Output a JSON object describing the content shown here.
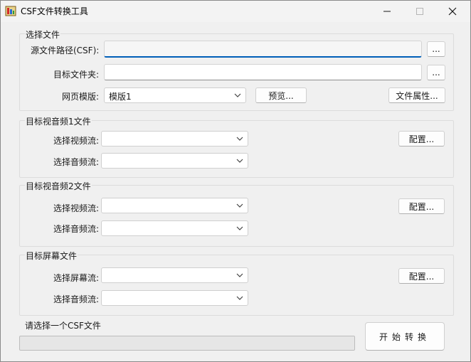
{
  "window": {
    "title": "CSF文件转换工具"
  },
  "source_group": {
    "title": "选择文件",
    "source_label": "源文件路径(CSF):",
    "source_value": "",
    "target_label": "目标文件夹:",
    "target_value": "",
    "browse_label": "...",
    "template_label": "网页模版:",
    "template_value": "模版1",
    "preview_label": "预览...",
    "properties_label": "文件属性..."
  },
  "av1_group": {
    "title": "目标视音频1文件",
    "video_label": "选择视频流:",
    "video_value": "",
    "audio_label": "选择音频流:",
    "audio_value": "",
    "config_label": "配置..."
  },
  "av2_group": {
    "title": "目标视音频2文件",
    "video_label": "选择视频流:",
    "video_value": "",
    "audio_label": "选择音频流:",
    "audio_value": "",
    "config_label": "配置..."
  },
  "screen_group": {
    "title": "目标屏幕文件",
    "screen_label": "选择屏幕流:",
    "screen_value": "",
    "audio_label": "选择音频流:",
    "audio_value": "",
    "config_label": "配置..."
  },
  "status": {
    "text": "请选择一个CSF文件",
    "progress": 0,
    "convert_label": "开始转换"
  },
  "colors": {
    "accent": "#005fb8",
    "progress": "#06b025"
  },
  "icons": [
    "app-icon",
    "minimize-icon",
    "maximize-icon",
    "close-icon",
    "chevron-down-icon"
  ]
}
